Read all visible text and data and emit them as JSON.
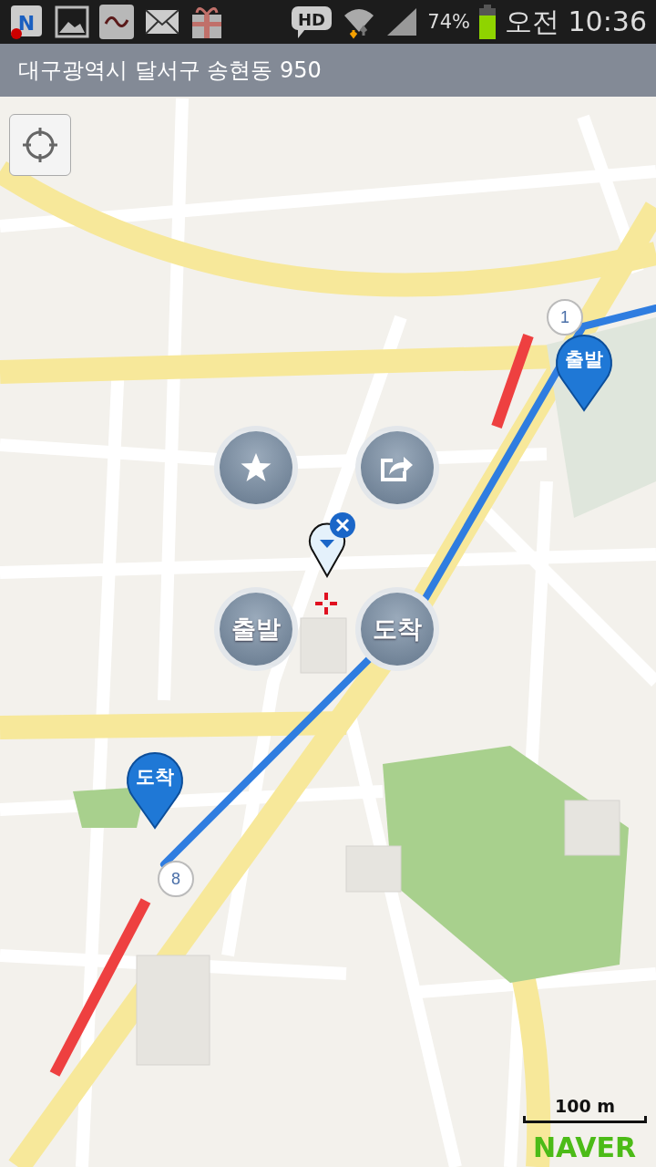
{
  "status_bar": {
    "app_badge": "N",
    "hd": "HD",
    "battery": "74%",
    "time": "오전 10:36"
  },
  "address_bar": {
    "address": "대구광역시 달서구 송현동 950"
  },
  "radial_menu": [
    {
      "kind": "star"
    },
    {
      "kind": "share"
    },
    {
      "kind": "text",
      "label": "출발"
    },
    {
      "kind": "text",
      "label": "도착"
    }
  ],
  "markers": [
    {
      "kind": "waypoint",
      "label": "1"
    },
    {
      "kind": "waypoint",
      "label": "8"
    },
    {
      "kind": "pin",
      "label": "출발"
    },
    {
      "kind": "pin",
      "label": "도착"
    }
  ],
  "scale": "100 m",
  "logo": "NAVER"
}
